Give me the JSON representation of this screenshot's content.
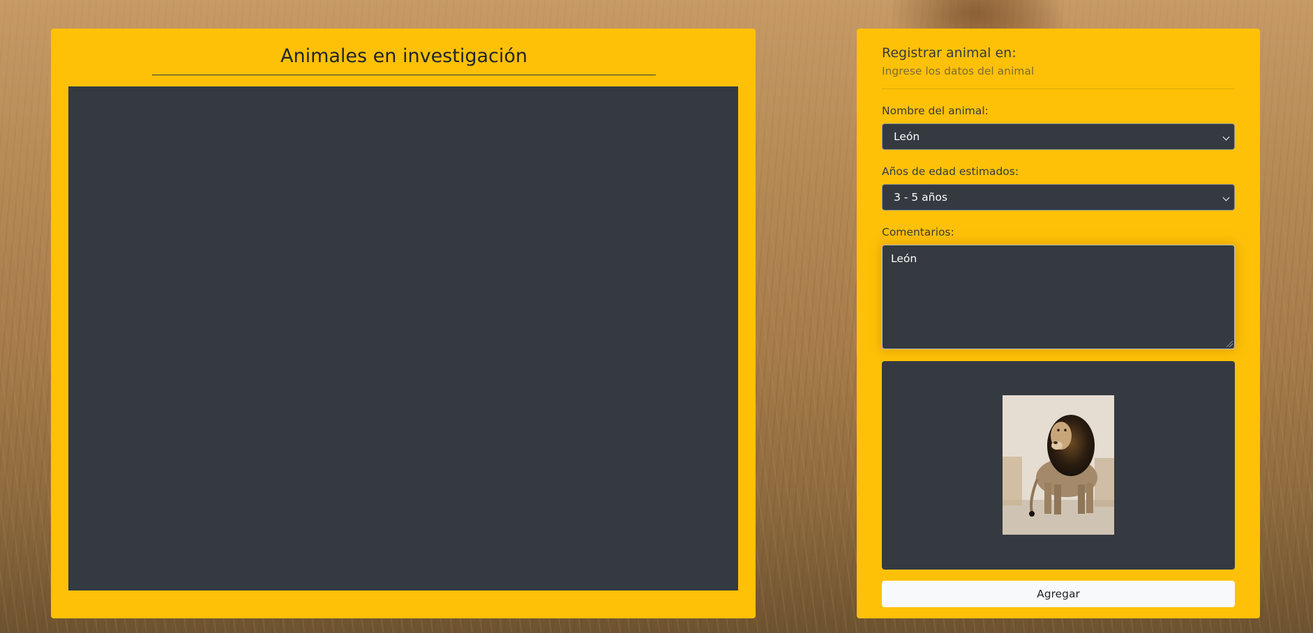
{
  "left_card": {
    "title": "Animales en investigación"
  },
  "form": {
    "title": "Registrar animal en:",
    "subtitle": "Ingrese los datos del animal",
    "animal_label": "Nombre del animal:",
    "animal_value": "León",
    "age_label": "Años de edad estimados:",
    "age_value": "3 - 5 años",
    "comments_label": "Comentarios:",
    "comments_value": "León",
    "add_button": "Agregar"
  },
  "icons": {
    "select_arrow": "chevron-down-icon",
    "textarea_resize": "resize-grip-icon"
  },
  "colors": {
    "card": "#ffc107",
    "panel": "#343a40",
    "button": "#f8f9fa"
  }
}
